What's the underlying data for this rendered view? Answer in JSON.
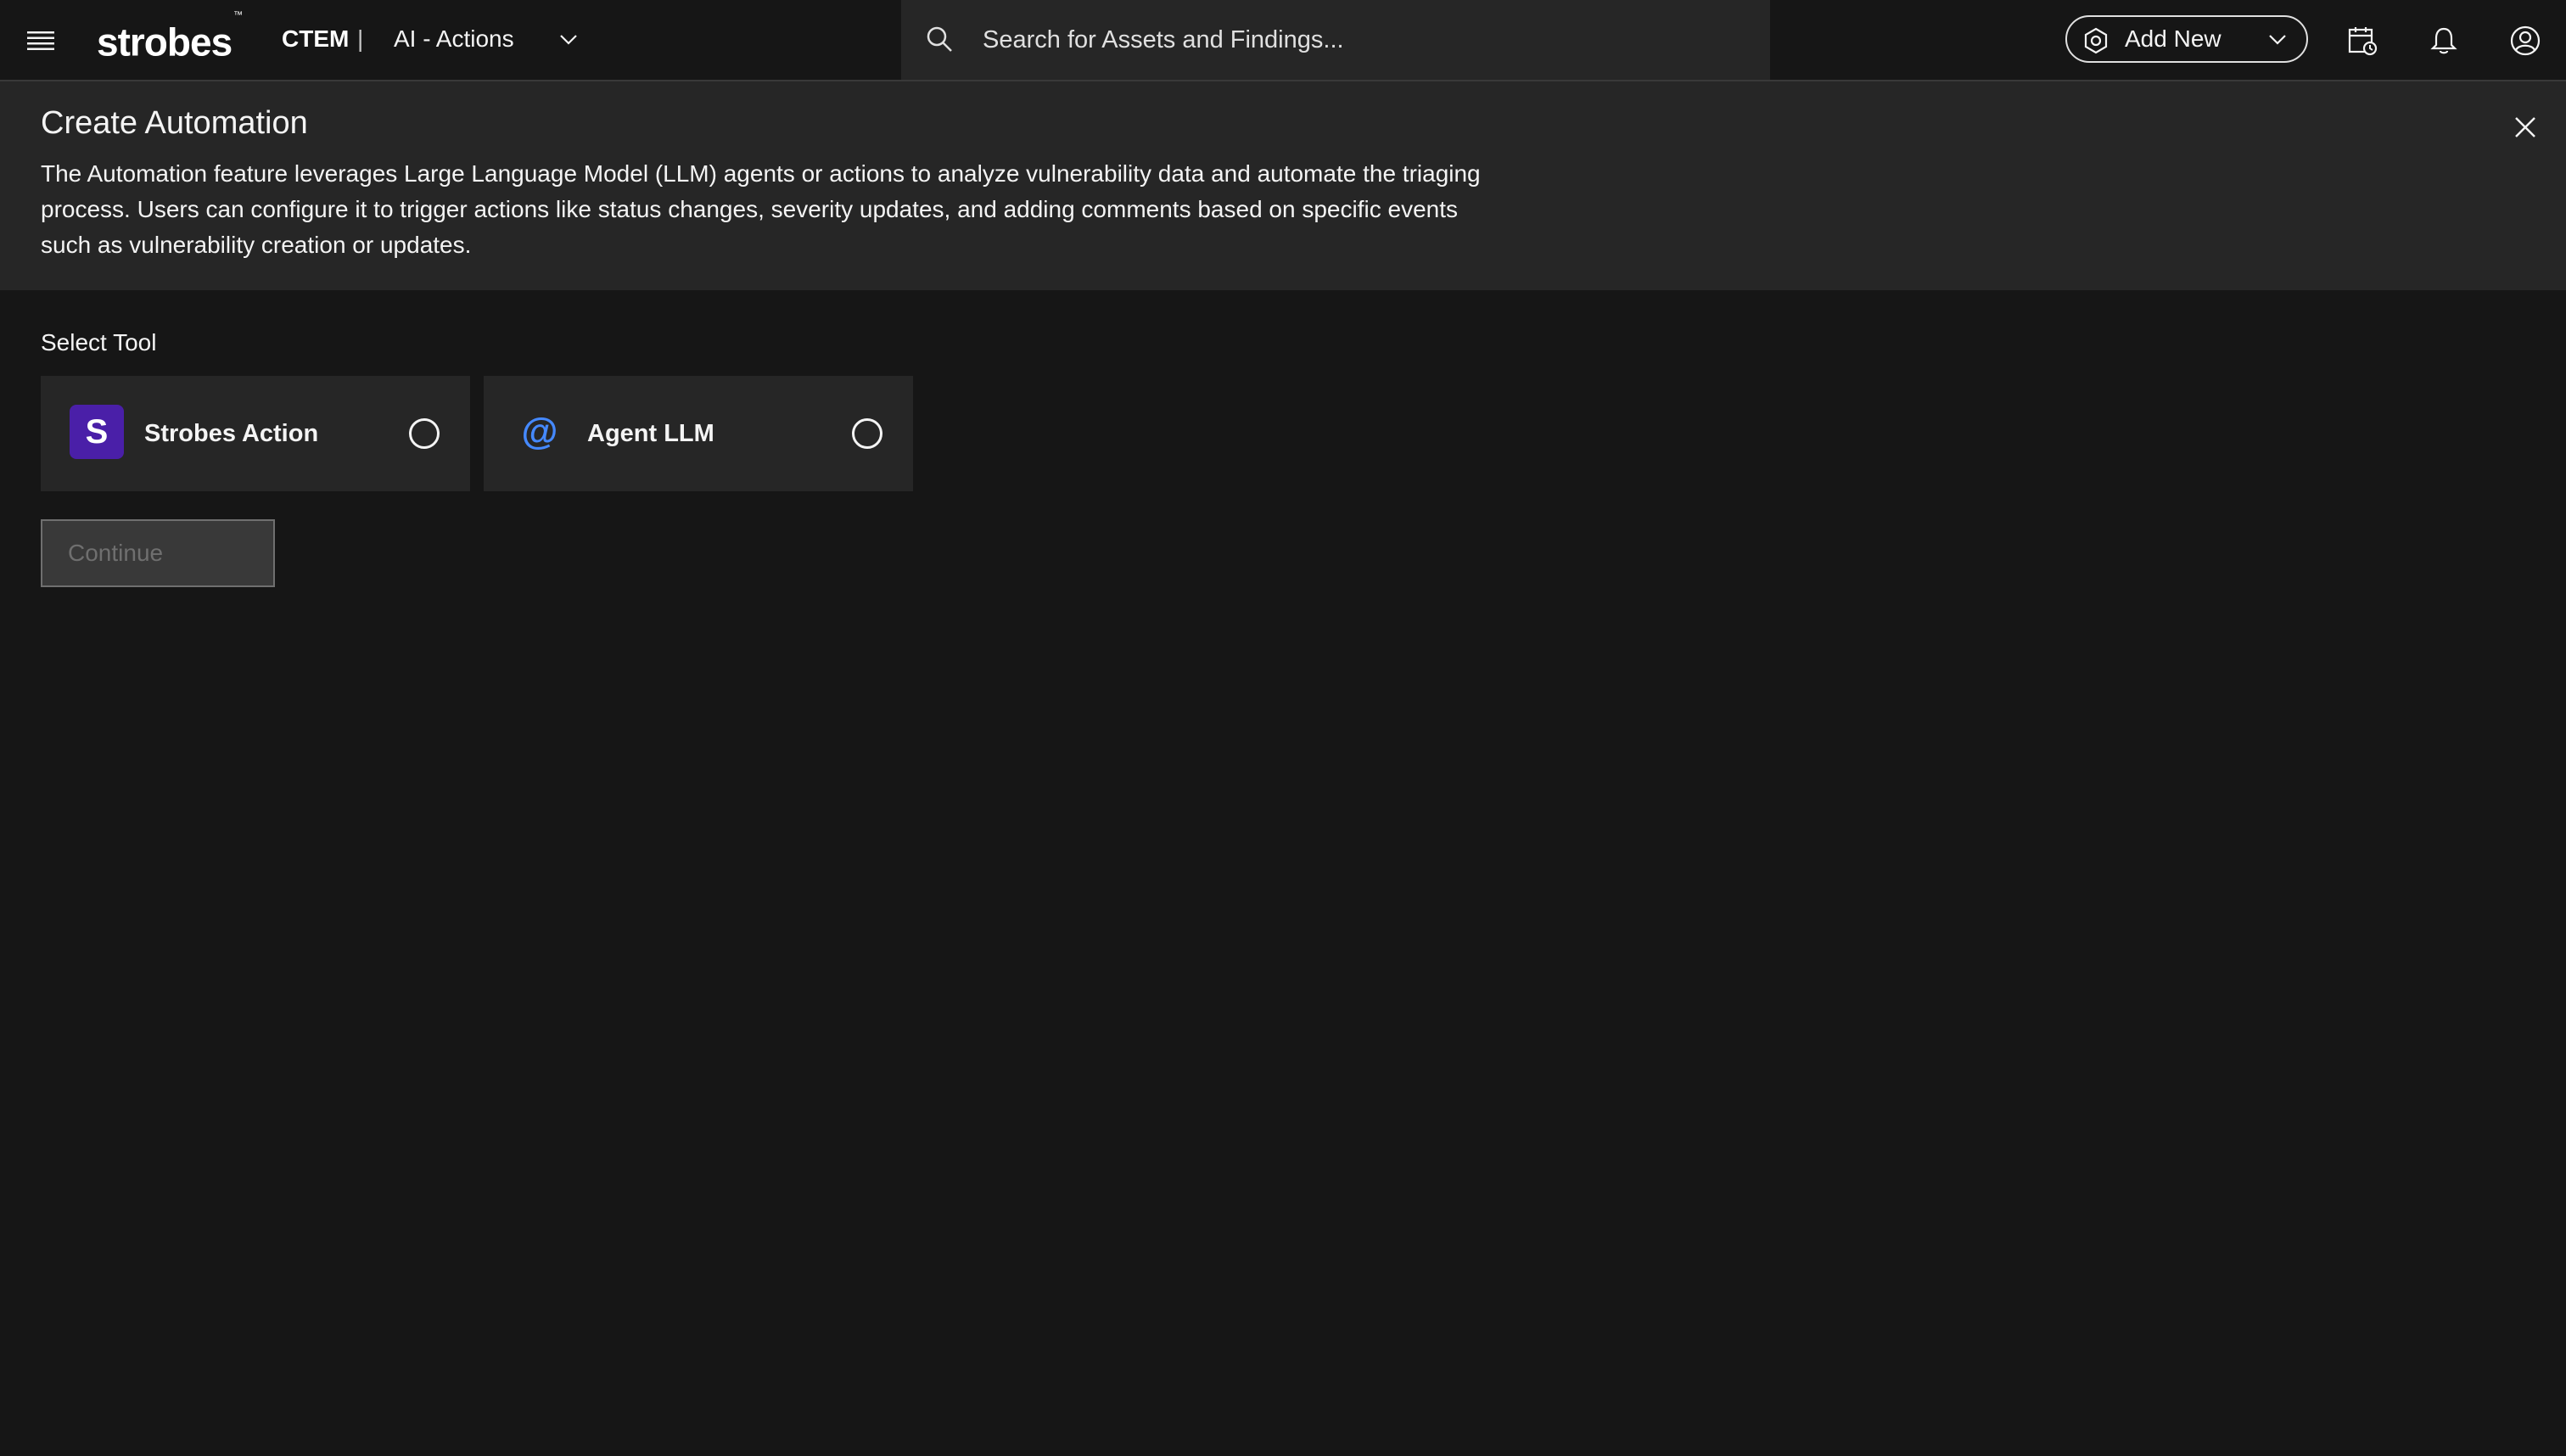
{
  "topbar": {
    "logo_text": "strobes",
    "logo_tm": "™",
    "product": "CTEM",
    "separator": "|",
    "section": "AI - Actions",
    "search_placeholder": "Search for Assets and Findings...",
    "add_new_label": "Add New",
    "icons": [
      "menu-icon",
      "chevron-down-icon",
      "search-icon",
      "settings-hexagon-icon",
      "calendar-schedule-icon",
      "bell-icon",
      "user-avatar-icon"
    ]
  },
  "header": {
    "title": "Create Automation",
    "description": "The Automation feature leverages Large Language Model (LLM) agents or actions to analyze vulnerability data and automate the triaging process. Users can configure it to trigger actions like status changes, severity updates, and adding comments based on specific events such as vulnerability creation or updates."
  },
  "main": {
    "select_tool_label": "Select Tool",
    "tools": [
      {
        "name": "Strobes Action",
        "icon_glyph": "S",
        "icon": "strobes-logo-icon",
        "selected": false
      },
      {
        "name": "Agent LLM",
        "icon_glyph": "@",
        "icon": "at-sign-icon",
        "selected": false
      }
    ],
    "continue_label": "Continue"
  },
  "colors": {
    "background": "#161616",
    "panel": "#262626",
    "strobes_purple": "#4a1fa8",
    "agent_blue": "#4589ff",
    "disabled_text": "#6f6f6f"
  }
}
